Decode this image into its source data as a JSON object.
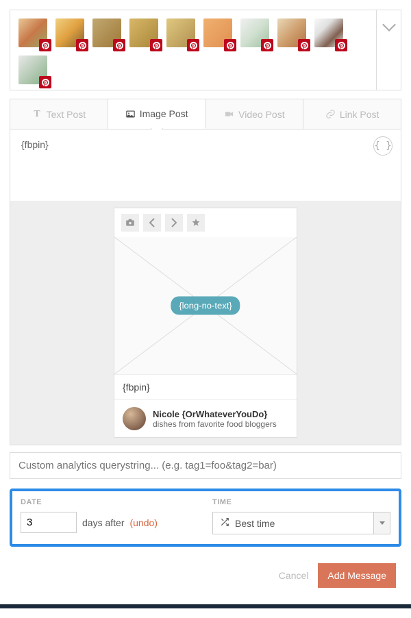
{
  "thumbnails": {
    "count": 10
  },
  "tabs": {
    "text": "Text Post",
    "image": "Image Post",
    "video": "Video Post",
    "link": "Link Post"
  },
  "editor": {
    "content": "{fbpin}"
  },
  "preview": {
    "placeholder_badge": "{long-no-text}",
    "caption": "{fbpin}",
    "author_name": "Nicole {OrWhateverYouDo}",
    "author_sub": "dishes from favorite food bloggers"
  },
  "analytics": {
    "placeholder": "Custom analytics querystring... (e.g. tag1=foo&tag2=bar)"
  },
  "schedule": {
    "date_label": "DATE",
    "date_value": "3",
    "days_after": "days after",
    "undo": "(undo)",
    "time_label": "TIME",
    "best_time": "Best time"
  },
  "footer": {
    "cancel": "Cancel",
    "add_message": "Add Message"
  }
}
